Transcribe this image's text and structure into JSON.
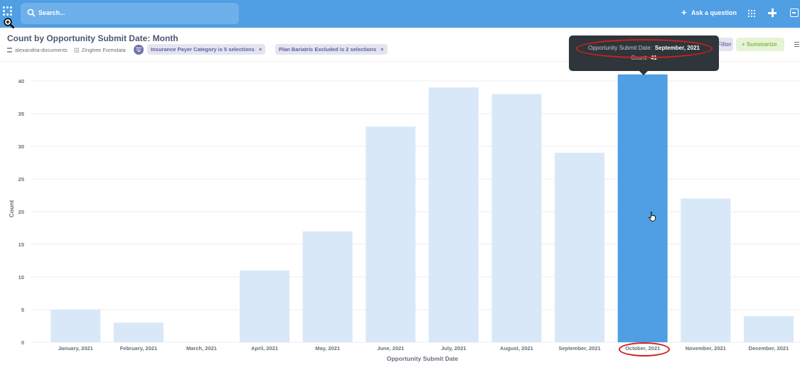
{
  "topbar": {
    "search_placeholder": "Search...",
    "ask_label": "Ask a question",
    "colors": {
      "brand": "#509ee3"
    },
    "icons": [
      "metabase-logo-icon",
      "zoom-in-cursor-icon",
      "search-icon",
      "plus-icon",
      "apps-grid-icon",
      "new-plus-icon",
      "activity-panel-icon"
    ]
  },
  "header": {
    "title": "Count by Opportunity Submit Date: Month",
    "database": "alexandria-documents",
    "table": "Zingtree Formdata",
    "filters": [
      {
        "label": "Insurance Payer Category is 5 selections",
        "remove": "×"
      },
      {
        "label": "Plan Bariatric Excluded is 2 selections",
        "remove": "×"
      }
    ],
    "filter_button": "Filter",
    "summarize_button": "+ Summarize"
  },
  "tooltip": {
    "key1": "Opportunity Submit Date:",
    "value1": "September, 2021",
    "key2": "Count:",
    "value2": "41"
  },
  "chart_data": {
    "type": "bar",
    "xlabel": "Opportunity Submit Date",
    "ylabel": "Count",
    "ylim": [
      0,
      40
    ],
    "yticks": [
      "0",
      "5",
      "10",
      "15",
      "20",
      "25",
      "30",
      "35",
      "40"
    ],
    "categories": [
      "January, 2021",
      "February, 2021",
      "March, 2021",
      "April, 2021",
      "May, 2021",
      "June, 2021",
      "July, 2021",
      "August, 2021",
      "September, 2021",
      "October, 2021",
      "November, 2021",
      "December, 2021"
    ],
    "values": [
      5,
      3,
      0,
      11,
      17,
      33,
      39,
      38,
      29,
      41,
      22,
      4
    ],
    "highlighted_index": 9,
    "colors": {
      "bar": "#d9e8f8",
      "highlight": "#509ee3"
    },
    "grid": true
  }
}
